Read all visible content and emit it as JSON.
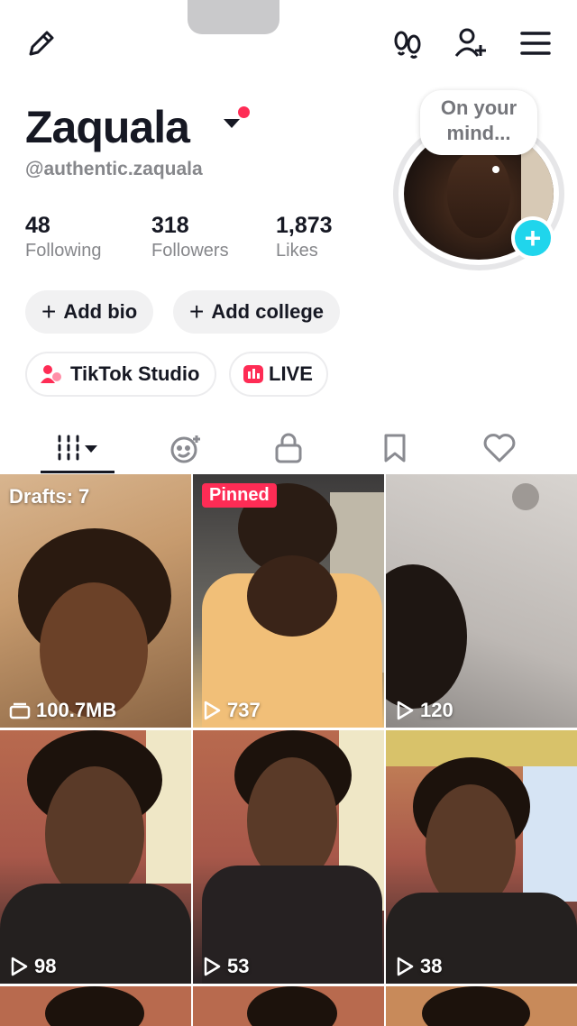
{
  "profile": {
    "username": "Zaquala",
    "handle": "@authentic.zaquala",
    "thought_bubble": "On your mind...",
    "stats": [
      {
        "value": "48",
        "label": "Following"
      },
      {
        "value": "318",
        "label": "Followers"
      },
      {
        "value": "1,873",
        "label": "Likes"
      }
    ]
  },
  "actions": {
    "add_bio": "Add bio",
    "add_college": "Add college",
    "studio": "TikTok Studio",
    "live": "LIVE"
  },
  "tabs": [
    "grid-icon",
    "repost-icon",
    "lock-icon",
    "bookmark-icon",
    "heart-icon"
  ],
  "videos": [
    {
      "overlay": "Drafts: 7",
      "meta": "100.7MB",
      "meta_icon": "drafts-icon"
    },
    {
      "overlay": "Pinned",
      "meta": "737",
      "meta_icon": "play-icon"
    },
    {
      "overlay": "",
      "meta": "120",
      "meta_icon": "play-icon"
    },
    {
      "overlay": "",
      "meta": "98",
      "meta_icon": "play-icon"
    },
    {
      "overlay": "",
      "meta": "53",
      "meta_icon": "play-icon"
    },
    {
      "overlay": "",
      "meta": "38",
      "meta_icon": "play-icon"
    }
  ],
  "colors": {
    "accent": "#fe2c55",
    "badge": "#20d5ec",
    "text": "#161823",
    "muted": "#86878b"
  }
}
